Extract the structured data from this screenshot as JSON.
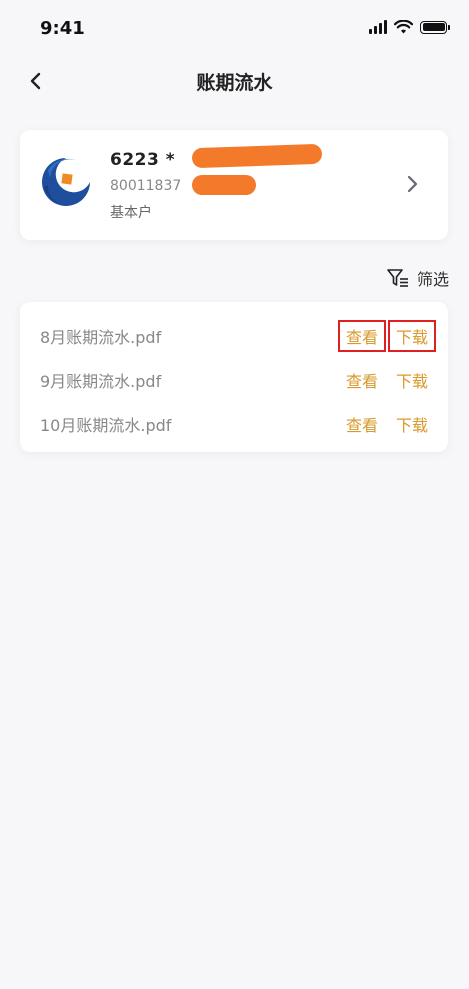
{
  "status": {
    "time": "9:41"
  },
  "nav": {
    "title": "账期流水"
  },
  "account": {
    "number": "6223 *",
    "sub_number": "80011837",
    "type": "基本户"
  },
  "filter": {
    "label": "筛选"
  },
  "files": [
    {
      "name": "8月账期流水.pdf",
      "view": "查看",
      "download": "下载"
    },
    {
      "name": "9月账期流水.pdf",
      "view": "查看",
      "download": "下载"
    },
    {
      "name": "10月账期流水.pdf",
      "view": "查看",
      "download": "下载"
    }
  ],
  "colors": {
    "accent": "#d99a2b",
    "highlight": "#e02020",
    "redaction": "#f27a2a",
    "bank_blue": "#1f4e9c"
  },
  "icons": [
    "signal-icon",
    "wifi-icon",
    "battery-icon",
    "back-arrow-icon",
    "bank-logo-icon",
    "chevron-right-icon",
    "filter-icon"
  ]
}
